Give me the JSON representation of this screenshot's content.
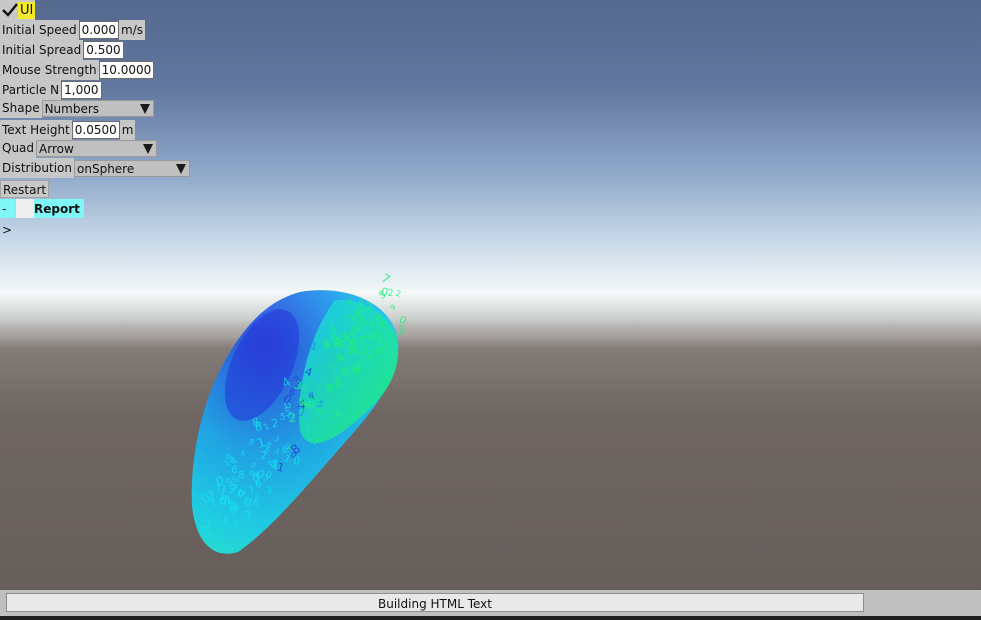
{
  "ui_toggle": {
    "label": "UI",
    "checked": true
  },
  "controls": {
    "initial_speed": {
      "label": "Initial Speed",
      "value": "0.000",
      "unit": "m/s"
    },
    "initial_spread": {
      "label": "Initial Spread",
      "value": "0.500"
    },
    "mouse_strength": {
      "label": "Mouse Strength",
      "value": "10.0000"
    },
    "particle_n": {
      "label": "Particle N",
      "value": "1,000"
    },
    "shape": {
      "label": "Shape",
      "selected": "Numbers"
    },
    "text_height": {
      "label": "Text Height",
      "value": "0.0500",
      "unit": "m"
    },
    "quad": {
      "label": "Quad",
      "selected": "Arrow"
    },
    "distribution": {
      "label": "Distribution",
      "selected": "onSphere"
    }
  },
  "restart_button": {
    "label": "Restart"
  },
  "report_toggle": {
    "arrow": "->",
    "label": "Report",
    "checked": false
  },
  "status": {
    "text": "Building HTML Text",
    "progress": 0.88
  },
  "colors": {
    "ui_highlight": "#f4ea2a",
    "report_highlight": "#7ff7f7",
    "panel_gray": "#c7c7c7",
    "particle_blue": "#1e3fd8",
    "particle_cyan": "#18e0f0",
    "particle_green": "#1ef07a"
  }
}
